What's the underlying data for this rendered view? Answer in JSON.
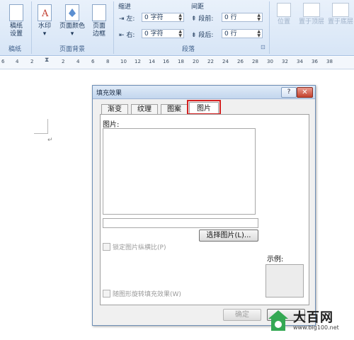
{
  "ribbon": {
    "paper_group": {
      "label": "稿纸",
      "button_line1": "稿纸",
      "button_line2": "设置"
    },
    "background_group": {
      "label": "页面背景",
      "watermark": "水印",
      "page_color": "页面颜色",
      "page_border_line1": "页面",
      "page_border_line2": "边框"
    },
    "paragraph_group": {
      "label": "段落",
      "indent_title": "缩进",
      "spacing_title": "间距",
      "indent_left_label": "左:",
      "indent_left_value": "0 字符",
      "indent_right_label": "右:",
      "indent_right_value": "0 字符",
      "spacing_before_label": "段前:",
      "spacing_before_value": "0 行",
      "spacing_after_label": "段后:",
      "spacing_after_value": "0 行"
    },
    "arrange_group": {
      "position": "位置",
      "bring_front": "置于顶层",
      "send_back": "置于底层"
    }
  },
  "ruler": {
    "ticks": [
      "6",
      "4",
      "2",
      "2",
      "4",
      "6",
      "8",
      "10",
      "12",
      "14",
      "16",
      "18",
      "20",
      "22",
      "24",
      "26",
      "28",
      "30",
      "32",
      "34",
      "36",
      "38"
    ]
  },
  "dialog": {
    "title": "填充效果",
    "help": "?",
    "close": "✕",
    "tabs": [
      "渐变",
      "纹理",
      "图案",
      "图片"
    ],
    "active_tab": "图片",
    "picture_label": "图片:",
    "select_picture_button": "选择图片(L)...",
    "lock_aspect_label": "锁定图片纵横比(P)",
    "rotate_with_shape_label": "随图形旋转填充效果(W)",
    "sample_label": "示例:",
    "ok_button": "确定"
  },
  "watermark": {
    "brand": "大百网",
    "url": "www.big100.net"
  },
  "colors": {
    "ribbon_top": "#e9f1fb",
    "ribbon_bottom": "#d7e5f6",
    "highlight": "#d42020",
    "logo_green": "#34a853",
    "logo_text": "#1f1f1f"
  }
}
